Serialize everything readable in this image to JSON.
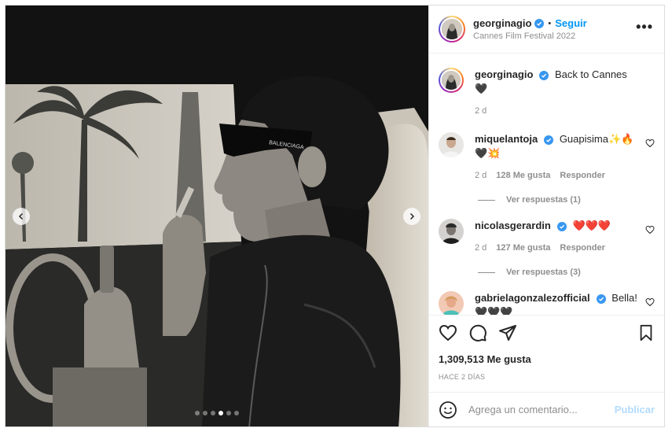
{
  "header": {
    "username": "georginagio",
    "separator": "•",
    "follow_label": "Seguir",
    "location": "Cannes Film Festival 2022",
    "more_label": "•••"
  },
  "caption": {
    "username": "georginagio",
    "text": "Back to Cannes 🖤",
    "time": "2 d"
  },
  "comments": [
    {
      "username": "miquelantoja",
      "text": "Guapisima✨🔥🖤💥",
      "time": "2 d",
      "likes": "128 Me gusta",
      "reply_label": "Responder",
      "view_replies": "Ver respuestas (1)"
    },
    {
      "username": "nicolasgerardin",
      "text": "❤️❤️❤️",
      "time": "2 d",
      "likes": "127 Me gusta",
      "reply_label": "Responder",
      "view_replies": "Ver respuestas (3)"
    },
    {
      "username": "gabrielagonzalezofficial",
      "text": "Bella! 🖤🖤🖤"
    }
  ],
  "actions": {
    "like_icon": "heart-icon",
    "comment_icon": "comment-icon",
    "share_icon": "send-icon",
    "save_icon": "bookmark-icon"
  },
  "likes_count": "1,309,513 Me gusta",
  "posted_ago": "HACE 2 DÍAS",
  "add_comment": {
    "placeholder": "Agrega un comentario...",
    "publish_label": "Publicar"
  },
  "carousel": {
    "total": 6,
    "active_index": 4
  },
  "colors": {
    "accent": "#0095f6",
    "publish_disabled": "#b3dbff",
    "muted": "#8e8e8e",
    "verified": "#3897f0"
  }
}
